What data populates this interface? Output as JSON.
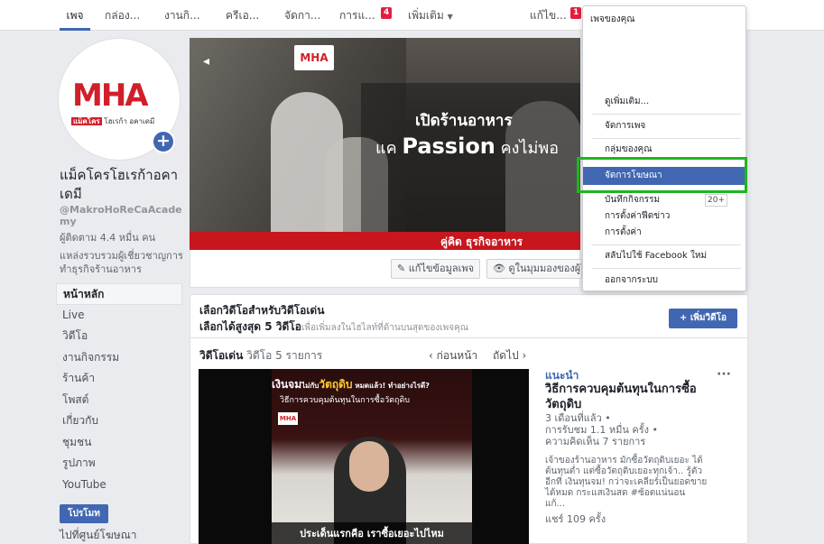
{
  "topnav": {
    "tabs": [
      "เพจ",
      "กล่อง...",
      "งานกิ...",
      "ครีเอ...",
      "จัดกา...",
      "การแ...",
      "เพิ่มเติม"
    ],
    "notif_badge": "4",
    "edit_label": "แก้ไข...",
    "edit_badge": "1"
  },
  "page": {
    "name": "แม็คโครโฮเรก้าอคาเดมี",
    "handle": "@MakroHoReCaAcademy",
    "followers": "ผู้ติดตาม 4.4 หมื่น คน",
    "description": "แหล่งรวบรวมผู้เชี่ยวชาญการทำธุรกิจร้านอาหาร",
    "logo_text": "MHA",
    "logo_sub_a": "แม็คโคร",
    "logo_sub_b": "โฮเรก้า อคาเดมี"
  },
  "leftnav": {
    "items": [
      "หน้าหลัก",
      "Live",
      "วิดีโอ",
      "งานกิจกรรม",
      "ร้านค้า",
      "โพสต์",
      "เกี่ยวกับ",
      "ชุมชน",
      "รูปภาพ",
      "YouTube"
    ],
    "promote": "โปรโมท",
    "ad_center": "ไปที่ศูนย์โฆษณา"
  },
  "cover": {
    "logo": "MHA",
    "line1": "เปิดร้านอาหาร",
    "line2_a": "แค ",
    "line2_b": "Passion",
    "line2_c": " คงไม่พอ",
    "bar_text": "คู่คิด  ธุรกิจอาหาร"
  },
  "actions": {
    "edit_info": "✎ แก้ไขข้อมูลเพจ",
    "view_as": "👁 ดูในมุมมองของผู้ใช้"
  },
  "featured": {
    "title": "เลือกวิดีโอสำหรับวิดีโอเด่น",
    "sub_bold": "เลือกได้สูงสุด 5 วิดีโอ",
    "sub_small": "เพื่อเพิ่มลงในไฮไลท์ที่ด้านบนสุดของเพจคุณ",
    "add_button": "+ เพิ่มวิดีโอ",
    "label_bold": "วิดีโอเด่น",
    "label_count": "วิดีโอ 5 รายการ",
    "prev": "‹ ก่อนหน้า",
    "next": "ถัดไป ›"
  },
  "video": {
    "headline_a": "เงินจม",
    "headline_b": "ไม่กับ",
    "headline_c": "วัตถุดิบ",
    "headline_d": " หมดแล้ว! ทำอย่างไรดี?",
    "subline": "วิธีการควบคุมต้นทุนในการซื้อวัตถุดิบ",
    "logo": "MHA",
    "caption": "ประเด็นแรกคือ เราซื้อเยอะไปไหม"
  },
  "recommend": {
    "label": "แนะนำ",
    "more": "···",
    "title": "วิธีการควบคุมต้นทุนในการซื้อวัตถุดิบ",
    "meta": "3 เดือนที่แล้ว •\nการรับชม 1.1 หมื่น ครั้ง •\nความคิดเห็น 7 รายการ",
    "desc": "เจ้าของร้านอาหาร มักซื้อวัตถุดิบเยอะ ได้ต้นทุนต่ำ แต่ซื้อวัตถุดิบเยอะทุกเจ้า.. รู้ตัวอีกที เงินทุนจม! กว่าจะเคลียร์เป็นยอดขายได้หมด กระแสเงินสด #ซ้อตแน่นอน แก้...",
    "shares": "แชร์ 109 ครั้ง"
  },
  "dropdown": {
    "header": "เพจของคุณ",
    "see_more": "ดูเพิ่มเติม...",
    "manage_page": "จัดการเพจ",
    "your_groups": "กลุ่มของคุณ",
    "manage_ads": "จัดการโฆษณา",
    "activity_log": "บันทึกกิจกรรม",
    "activity_count": "20+",
    "news_prefs": "การตั้งค่าฟีดข่าว",
    "settings": "การตั้งค่า",
    "switch_fb": "สลับไปใช้ Facebook ใหม่",
    "logout": "ออกจากระบบ"
  },
  "colors": {
    "accent": "#4267b2",
    "brand_red": "#d11f2a",
    "highlight_green": "#1fb51f"
  }
}
